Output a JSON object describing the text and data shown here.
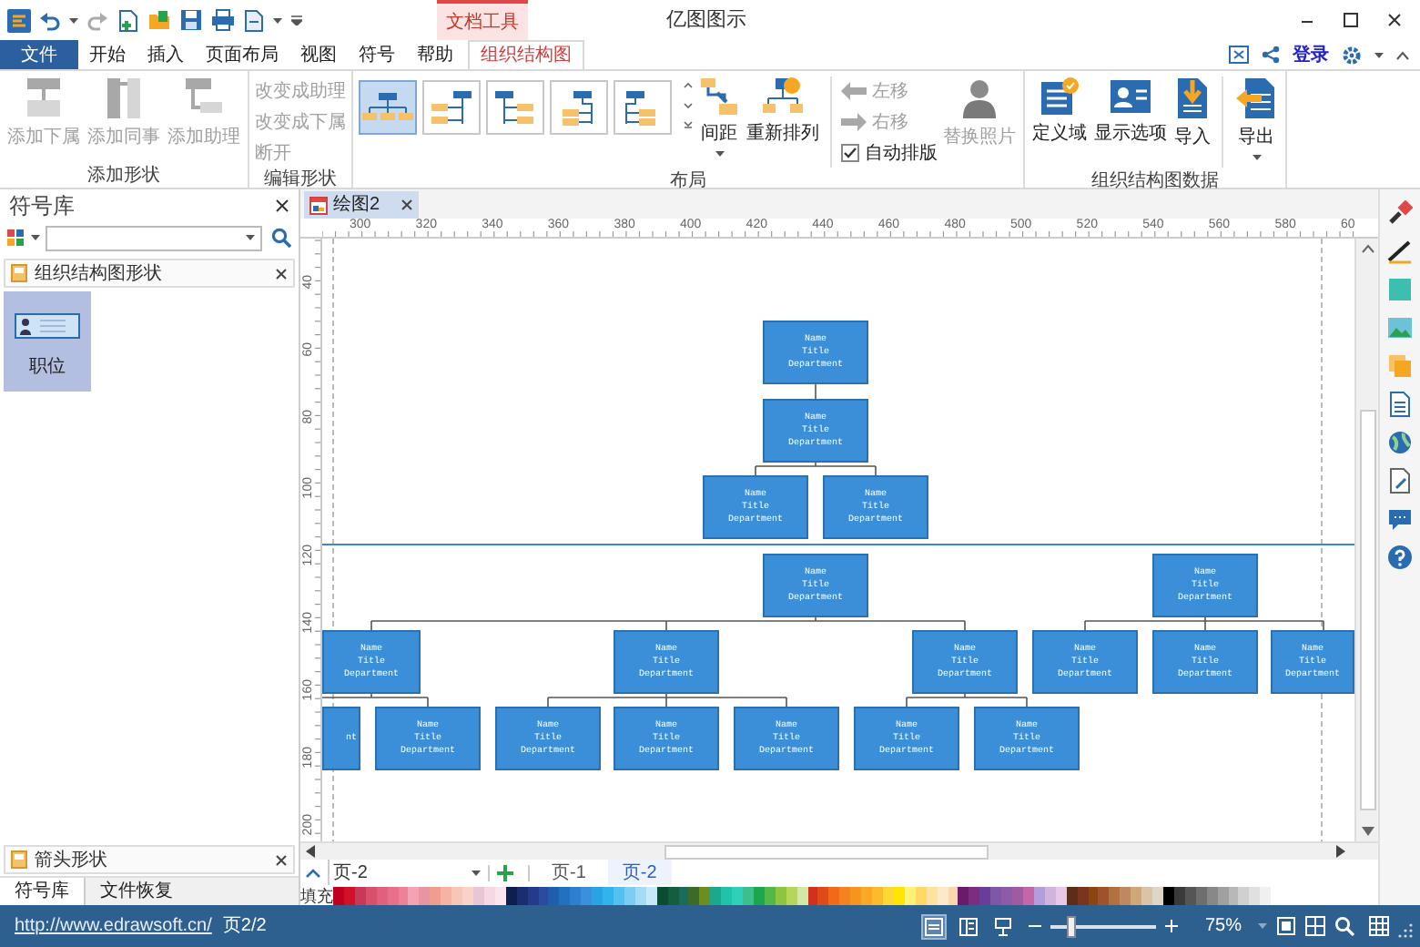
{
  "window": {
    "title": "亿图图示",
    "context_tab": "文档工具"
  },
  "menu_tabs": [
    {
      "label": "文件",
      "kind": "file",
      "selected": false
    },
    {
      "label": "开始",
      "kind": "tab",
      "selected": false
    },
    {
      "label": "插入",
      "kind": "tab",
      "selected": false
    },
    {
      "label": "页面布局",
      "kind": "tab",
      "selected": false
    },
    {
      "label": "视图",
      "kind": "tab",
      "selected": false
    },
    {
      "label": "符号",
      "kind": "tab",
      "selected": false
    },
    {
      "label": "帮助",
      "kind": "tab",
      "selected": false
    },
    {
      "label": "组织结构图",
      "kind": "tab",
      "selected": true
    }
  ],
  "account": {
    "login": "登录"
  },
  "ribbon": [
    {
      "label": "添加形状",
      "items": [
        {
          "kind": "large",
          "label": "添加下属",
          "disabled": true,
          "dropdown": false
        },
        {
          "kind": "large",
          "label": "添加同事",
          "disabled": true,
          "dropdown": false
        },
        {
          "kind": "large",
          "label": "添加助理",
          "disabled": true,
          "dropdown": false
        }
      ]
    },
    {
      "label": "编辑形状",
      "items": [
        {
          "kind": "small",
          "label": "改变成助理",
          "disabled": true
        },
        {
          "kind": "small",
          "label": "改变成下属",
          "disabled": true
        },
        {
          "kind": "small",
          "label": "断开",
          "disabled": true
        }
      ]
    },
    {
      "label": "布局",
      "items": [
        {
          "kind": "gallery",
          "options": [
            {
              "selected": true
            },
            {
              "selected": false
            },
            {
              "selected": false
            },
            {
              "selected": false
            },
            {
              "selected": false
            }
          ]
        },
        {
          "kind": "large",
          "label": "间距",
          "disabled": false,
          "dropdown": true
        },
        {
          "kind": "large",
          "label": "重新排列",
          "disabled": false,
          "dropdown": false
        },
        {
          "kind": "separator"
        },
        {
          "kind": "small",
          "label": "左移",
          "disabled": true
        },
        {
          "kind": "small",
          "label": "右移",
          "disabled": true
        },
        {
          "kind": "checkbox",
          "label": "自动排版",
          "checked": true
        },
        {
          "kind": "large",
          "label": "替换照片",
          "disabled": true,
          "dropdown": false
        }
      ]
    },
    {
      "label": "组织结构图数据",
      "items": [
        {
          "kind": "large",
          "label": "定义域",
          "disabled": false,
          "dropdown": false
        },
        {
          "kind": "large",
          "label": "显示选项",
          "disabled": false,
          "dropdown": false
        },
        {
          "kind": "large",
          "label": "导入",
          "disabled": false,
          "dropdown": false
        },
        {
          "kind": "separator"
        },
        {
          "kind": "large",
          "label": "导出",
          "disabled": false,
          "dropdown": true
        }
      ]
    }
  ],
  "symbol_library": {
    "title": "符号库",
    "sections": [
      {
        "title": "组织结构图形状",
        "shapes": [
          {
            "label": "职位",
            "selected": true
          }
        ]
      }
    ],
    "bottom_section": {
      "title": "箭头形状"
    },
    "tabs": [
      {
        "label": "符号库",
        "selected": true
      },
      {
        "label": "文件恢复",
        "selected": false
      }
    ]
  },
  "document_tabs": [
    {
      "label": "绘图2",
      "selected": true
    }
  ],
  "ruler": {
    "horizontal": [
      "300",
      "320",
      "340",
      "360",
      "380",
      "400",
      "420",
      "440",
      "460",
      "480",
      "500",
      "520",
      "540",
      "560",
      "580",
      "60"
    ],
    "vertical": [
      "40",
      "60",
      "80",
      "100",
      "120",
      "140",
      "160",
      "180",
      "200"
    ]
  },
  "org_chart": {
    "nodes": [
      {
        "name": "Name",
        "title": "Title",
        "department": "Department"
      },
      {
        "name": "Name",
        "title": "Title",
        "department": "Department"
      },
      {
        "name": "Name",
        "title": "Title",
        "department": "Department"
      },
      {
        "name": "Name",
        "title": "Title",
        "department": "Department"
      },
      {
        "name": "Name",
        "title": "Title",
        "department": "Department"
      },
      {
        "name": "Name",
        "title": "Title",
        "department": "Department"
      },
      {
        "name": "Name",
        "title": "Title",
        "department": "Department"
      },
      {
        "name": "Name",
        "title": "Title",
        "department": "Department"
      },
      {
        "name": "Name",
        "title": "Title",
        "department": "Department"
      },
      {
        "name": "Name",
        "title": "Title",
        "department": "Department"
      },
      {
        "name": "Name",
        "title": "Title",
        "department": "Department"
      },
      {
        "name": "Name",
        "title": "Title",
        "department": "Department"
      },
      {
        "department": "nt"
      },
      {
        "name": "Name",
        "title": "Title",
        "department": "Department"
      },
      {
        "name": "Name",
        "title": "Title",
        "department": "Department"
      },
      {
        "name": "Name",
        "title": "Title",
        "department": "Department"
      },
      {
        "name": "Name",
        "title": "Title",
        "department": "Department"
      },
      {
        "name": "Name",
        "title": "Title",
        "department": "Department"
      },
      {
        "name": "Name",
        "title": "Title",
        "department": "Department"
      }
    ]
  },
  "page_tabs": {
    "current": "页-2",
    "pages": [
      {
        "label": "页-1",
        "selected": false
      },
      {
        "label": "页-2",
        "selected": true
      }
    ]
  },
  "palette": {
    "label": "填充",
    "swatches": [
      {
        "color": "#c0001f"
      },
      {
        "color": "#d31027"
      },
      {
        "color": "#c8385a"
      },
      {
        "color": "#d9506c"
      },
      {
        "color": "#e0607e"
      },
      {
        "color": "#e86f8a"
      },
      {
        "color": "#f07f98"
      },
      {
        "color": "#f4a3b5"
      },
      {
        "color": "#e994a3"
      },
      {
        "color": "#f09d8f"
      },
      {
        "color": "#f6b2a2"
      },
      {
        "color": "#f8c5b8"
      },
      {
        "color": "#f9d2c8"
      },
      {
        "color": "#e8c6d6"
      },
      {
        "color": "#f6d8e4"
      },
      {
        "color": "#fbe4ec"
      },
      {
        "color": "#0d1f4d"
      },
      {
        "color": "#1a2e6e"
      },
      {
        "color": "#243a8a"
      },
      {
        "color": "#2c4aa0"
      },
      {
        "color": "#1f5fae"
      },
      {
        "color": "#2271c0"
      },
      {
        "color": "#2f7fd0"
      },
      {
        "color": "#3a90dd"
      },
      {
        "color": "#2aa3e6"
      },
      {
        "color": "#31b3ee"
      },
      {
        "color": "#52c0f0"
      },
      {
        "color": "#7ccdf2"
      },
      {
        "color": "#a3dbf5"
      },
      {
        "color": "#c6e8f8"
      },
      {
        "color": "#0d4d2f"
      },
      {
        "color": "#145e3f"
      },
      {
        "color": "#1a6b5a"
      },
      {
        "color": "#3a6b29"
      },
      {
        "color": "#6b8e23"
      },
      {
        "color": "#1aa98f"
      },
      {
        "color": "#22c2a9"
      },
      {
        "color": "#2fd0b8"
      },
      {
        "color": "#3cbf8a"
      },
      {
        "color": "#1ca74f"
      },
      {
        "color": "#52b84a"
      },
      {
        "color": "#8cc63f"
      },
      {
        "color": "#b5d65a"
      },
      {
        "color": "#d3e8a6"
      },
      {
        "color": "#d0321e"
      },
      {
        "color": "#e04a1a"
      },
      {
        "color": "#f06a1a"
      },
      {
        "color": "#f58220"
      },
      {
        "color": "#f7941d"
      },
      {
        "color": "#f9a825"
      },
      {
        "color": "#fbbc2b"
      },
      {
        "color": "#fdd835"
      },
      {
        "color": "#ffe500"
      },
      {
        "color": "#fff176"
      },
      {
        "color": "#ffd966"
      },
      {
        "color": "#fbe2a0"
      },
      {
        "color": "#fde9c9"
      },
      {
        "color": "#fbd5b0"
      },
      {
        "color": "#6a1b6a"
      },
      {
        "color": "#7b2d82"
      },
      {
        "color": "#6a3d9a"
      },
      {
        "color": "#7e57a8"
      },
      {
        "color": "#8e5ba8"
      },
      {
        "color": "#a05ba0"
      },
      {
        "color": "#c466a8"
      },
      {
        "color": "#b39ddb"
      },
      {
        "color": "#d1b3e0"
      },
      {
        "color": "#e8c8e8"
      },
      {
        "color": "#5d2d1a"
      },
      {
        "color": "#7a3520"
      },
      {
        "color": "#8b4513"
      },
      {
        "color": "#a0522d"
      },
      {
        "color": "#b07040"
      },
      {
        "color": "#c08860"
      },
      {
        "color": "#d0a878"
      },
      {
        "color": "#d9c4a8"
      },
      {
        "color": "#e0d6c8"
      },
      {
        "color": "#000000"
      },
      {
        "color": "#3a3a3a"
      },
      {
        "color": "#555555"
      },
      {
        "color": "#6e6e6e"
      },
      {
        "color": "#888888"
      },
      {
        "color": "#a0a0a0"
      },
      {
        "color": "#b8b8b8"
      },
      {
        "color": "#d0d0d0"
      },
      {
        "color": "#e0e0e0"
      },
      {
        "color": "#f0f0f0"
      }
    ]
  },
  "status_bar": {
    "link": "http://www.edrawsoft.cn/",
    "page": "页2/2",
    "views": [
      {
        "selected": true
      },
      {
        "selected": false
      },
      {
        "selected": false
      }
    ],
    "zoom": {
      "level": 0.2,
      "reading": "75%"
    }
  }
}
